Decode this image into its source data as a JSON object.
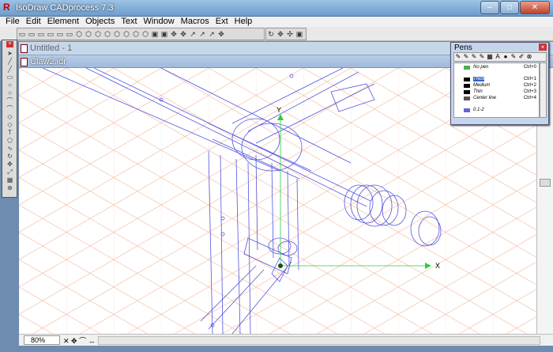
{
  "app": {
    "title": "IsoDraw CADprocess 7.3"
  },
  "window_buttons": {
    "minimize": "–",
    "maximize": "□",
    "close": "✕"
  },
  "menu": [
    "File",
    "Edit",
    "Element",
    "Objects",
    "Text",
    "Window",
    "Macros",
    "Ext",
    "Help"
  ],
  "documents": {
    "untitled": "Untitled - 1",
    "active": "Claw2.idr"
  },
  "canvas": {
    "axis_x": "X",
    "axis_y": "Y"
  },
  "status": {
    "zoom": "80%"
  },
  "pens_panel": {
    "title": "Pens",
    "items": [
      {
        "name": "No pen",
        "shortcut": "Ctrl+0",
        "color": "#4caf50"
      },
      {
        "name": "Thick",
        "shortcut": "Ctrl+1",
        "color": "#000000",
        "selected": true
      },
      {
        "name": "Medium",
        "shortcut": "Ctrl+2",
        "color": "#000000"
      },
      {
        "name": "Thin",
        "shortcut": "Ctrl+3",
        "color": "#000000"
      },
      {
        "name": "Center line",
        "shortcut": "Ctrl+4",
        "color": "#555555"
      },
      {
        "name": "0.1-2",
        "shortcut": "",
        "color": "#6666cc"
      }
    ]
  },
  "colors": {
    "grid": "#f2b89a",
    "geometry": "#5555dd",
    "x_axis": "#2ecc40",
    "y_axis": "#2ecc40"
  }
}
